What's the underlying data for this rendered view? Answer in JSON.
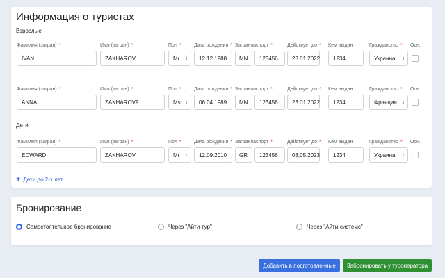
{
  "tourists": {
    "title": "Информация о туристах",
    "adults_label": "Взрослые",
    "children_label": "Дети",
    "columns": [
      "Фамилия (загран)",
      "Имя (загран)",
      "Пол",
      "Дата рождения",
      "Загранпаспорт",
      "Действует до",
      "Кем выдан",
      "Гражданство",
      "Осн."
    ],
    "required": "*",
    "rows": [
      {
        "surname": "IVAN",
        "name": "ZAKHAROV",
        "gender": "Mr",
        "birth": "12.12.1988",
        "series": "MN",
        "number": "123456",
        "valid": "23.01.2022",
        "issuer": "1234",
        "citizenship": "Украина",
        "main": false
      },
      {
        "surname": "ANNA",
        "name": "ZAKHAROVA",
        "gender": "Ms",
        "birth": "06.04.1989",
        "series": "MN",
        "number": "123456",
        "valid": "23.01.2022",
        "issuer": "1234",
        "citizenship": "Франция",
        "main": false
      },
      {
        "surname": "EDWARD",
        "name": "ZAKHAROV",
        "gender": "Mr",
        "birth": "12.09.2010",
        "series": "GR",
        "number": "123456",
        "valid": "08.05.2023",
        "issuer": "1234",
        "citizenship": "Украина",
        "main": false
      }
    ],
    "add_infants": "Дети до 2-х лет"
  },
  "booking": {
    "title": "Бронирование",
    "options": [
      "Самостоятельное бронирование",
      "Через \"Айти-тур\"",
      "Через \"Айти-системс\""
    ],
    "selected": 0
  },
  "actions": {
    "add_prepared": "Добавить в подготовленные",
    "book": "Забронировать у туроператора"
  },
  "colors": {
    "primary": "#3a6fe0",
    "success": "#2f8f33",
    "required": "#e33333"
  }
}
